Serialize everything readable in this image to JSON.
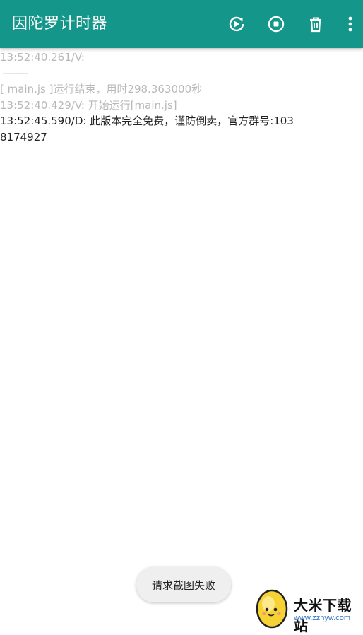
{
  "appbar": {
    "title": "因陀罗计时器",
    "actions": [
      {
        "icon": "rerun-icon"
      },
      {
        "icon": "stop-icon"
      },
      {
        "icon": "delete-icon"
      },
      {
        "icon": "more-vert-icon"
      }
    ],
    "color": "#14968a"
  },
  "log": {
    "lines": [
      {
        "text": "13:52:40.261/V:",
        "level": "V"
      },
      {
        "text": "------------",
        "level": "V"
      },
      {
        "text": "[ main.js ]运行结束，用时298.363000秒",
        "level": "V"
      },
      {
        "text": "13:52:40.429/V: 开始运行[main.js]",
        "level": "V"
      },
      {
        "text": "13:52:45.590/D: 此版本完全免费，谨防倒卖，官方群号:1038174927",
        "level": "D"
      }
    ]
  },
  "toast": {
    "text": "请求截图失败"
  },
  "watermark": {
    "site_name": "大米下载站",
    "url": "www.zzhyw.com"
  }
}
